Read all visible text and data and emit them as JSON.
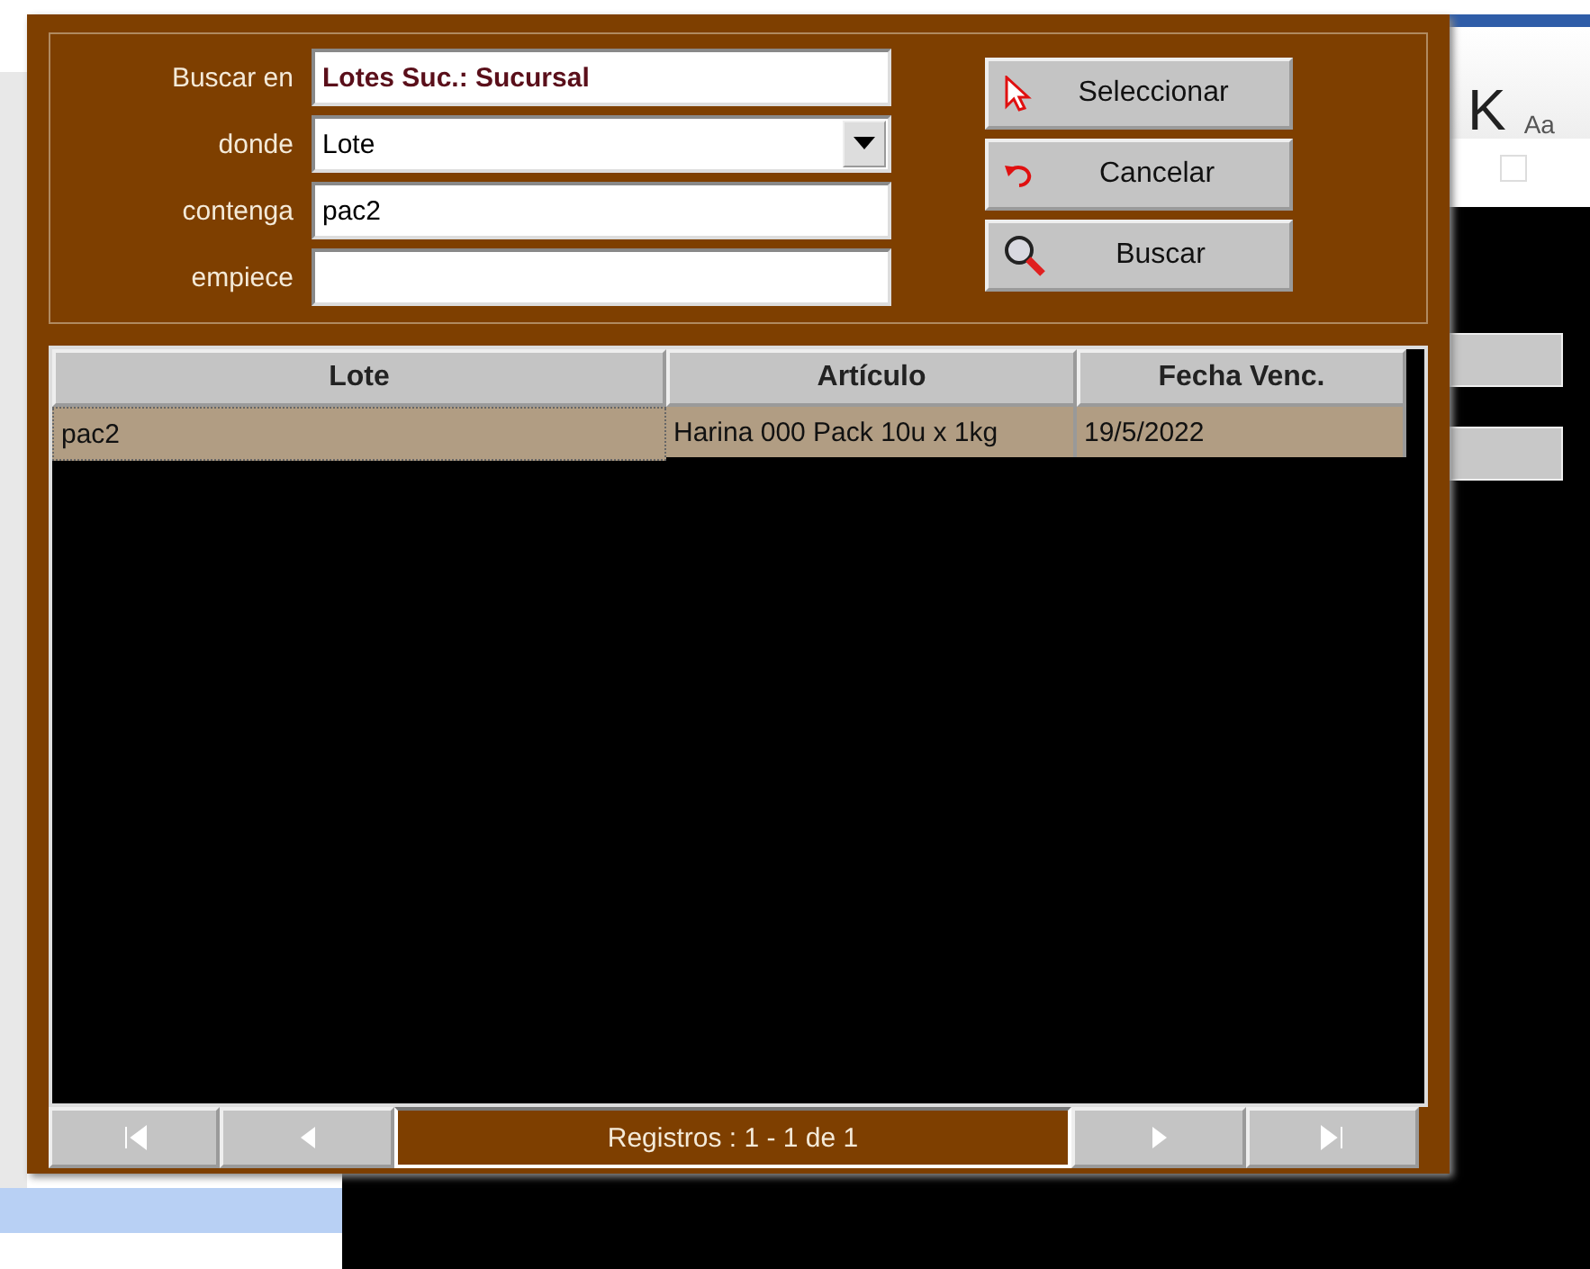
{
  "background": {
    "texts": [
      "K",
      "Aa"
    ],
    "checkbox": {
      "checked": false
    }
  },
  "search_form": {
    "fields": [
      {
        "label": "Buscar en",
        "kind": "title",
        "value": "Lotes Suc.: Sucursal"
      },
      {
        "label": "donde",
        "kind": "dropdown",
        "value": "Lote"
      },
      {
        "label": "contenga",
        "kind": "text",
        "value": "pac2"
      },
      {
        "label": "empiece",
        "kind": "text"
      }
    ],
    "buttons": [
      {
        "label": "Seleccionar",
        "kind": "select"
      },
      {
        "label": "Cancelar",
        "kind": "cancel"
      },
      {
        "label": "Buscar",
        "kind": "search"
      }
    ]
  },
  "table": {
    "columns": [
      "Lote",
      "Artículo",
      "Fecha Venc."
    ],
    "rows": [
      {
        "cells": [
          "pac2",
          "Harina 000 Pack 10u x 1kg",
          "19/5/2022"
        ],
        "selected": true
      }
    ]
  },
  "navigator": {
    "status": "Registros : 1 - 1 de 1"
  }
}
